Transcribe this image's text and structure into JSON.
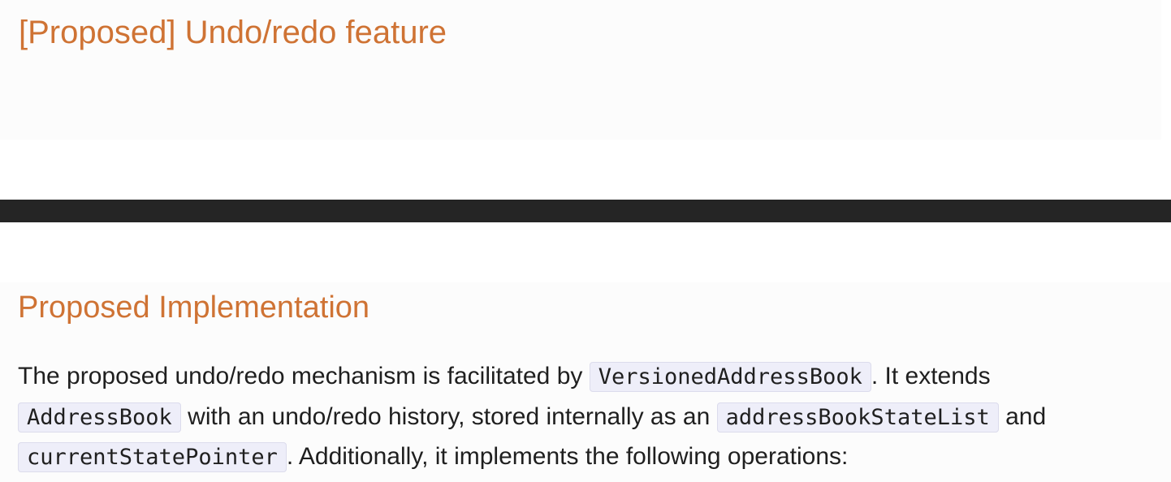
{
  "header": {
    "title": "[Proposed] Undo/redo feature"
  },
  "section": {
    "heading": "Proposed Implementation",
    "paragraph": {
      "t1": "The proposed undo/redo mechanism is facilitated by ",
      "code1": "VersionedAddressBook",
      "t2": ". It extends ",
      "code2": "AddressBook",
      "t3": " with an undo/redo history, stored internally as an ",
      "code3": "addressBookStateList",
      "t4": " and ",
      "code4": "currentStatePointer",
      "t5": ". Additionally, it implements the following operations:"
    }
  },
  "colors": {
    "heading": "#cf7334",
    "divider": "#252525",
    "code_background": "#eeeef9"
  }
}
